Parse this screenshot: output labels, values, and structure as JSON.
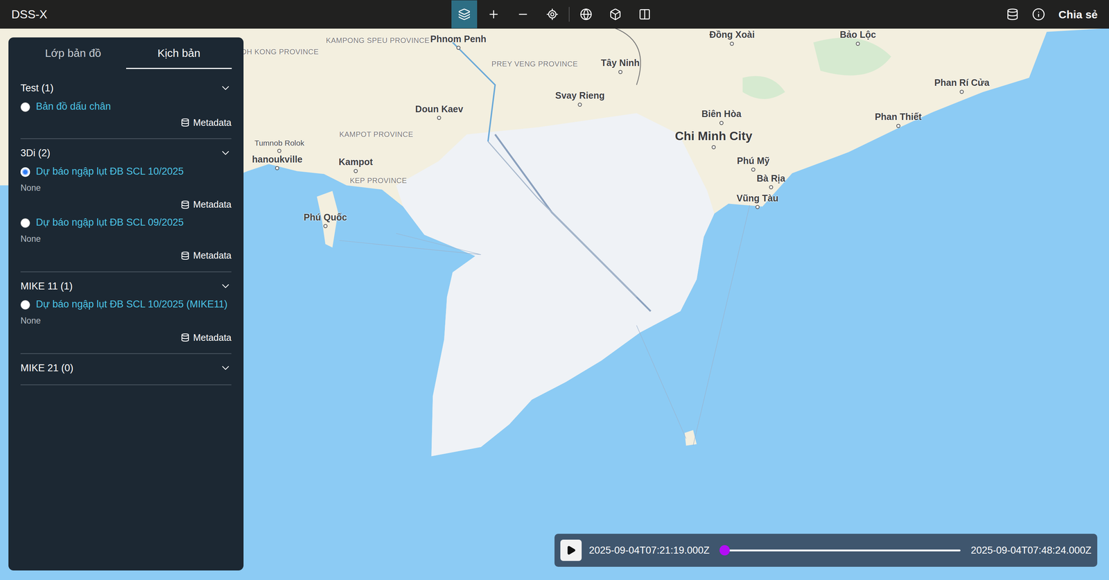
{
  "app": {
    "title": "DSS-X",
    "share": "Chia sẻ"
  },
  "toolbar": [
    {
      "selected": true
    },
    {
      "selected": false
    },
    {
      "selected": false
    },
    {
      "selected": false
    },
    {
      "selected": false
    },
    {
      "selected": false
    },
    {
      "selected": false
    }
  ],
  "panel": {
    "tabs": [
      {
        "label": "Lớp bản đồ",
        "selected": false
      },
      {
        "label": "Kịch bản",
        "selected": true
      }
    ],
    "groups": [
      {
        "title": "Test (1)",
        "expanded": true,
        "items": [
          {
            "label": "Bản đồ dấu chân",
            "selected": false,
            "note": "",
            "metadata": "Metadata"
          }
        ]
      },
      {
        "title": "3Di (2)",
        "expanded": true,
        "items": [
          {
            "label": "Dự báo ngập lụt ĐB SCL 10/2025",
            "selected": true,
            "note": "None",
            "metadata": "Metadata"
          },
          {
            "label": "Dự báo ngập lụt ĐB SCL 09/2025",
            "selected": false,
            "note": "None",
            "metadata": "Metadata"
          }
        ]
      },
      {
        "title": "MIKE 11 (1)",
        "expanded": true,
        "items": [
          {
            "label": "Dự báo ngập lụt ĐB SCL 10/2025 (MIKE11)",
            "selected": false,
            "note": "None",
            "metadata": "Metadata"
          }
        ]
      },
      {
        "title": "MIKE 21 (0)",
        "expanded": true,
        "items": []
      }
    ]
  },
  "map": {
    "labels": [
      {
        "text": "KOH KONG PROVINCE",
        "kind": "province"
      },
      {
        "text": "KAMPONG SPEU PROVINCE",
        "kind": "province"
      },
      {
        "text": "Phnom Penh",
        "kind": "city"
      },
      {
        "text": "PREY VENG PROVINCE",
        "kind": "province"
      },
      {
        "text": "Tây Ninh",
        "kind": "city"
      },
      {
        "text": "Đồng Xoài",
        "kind": "city"
      },
      {
        "text": "Bảo Lộc",
        "kind": "city"
      },
      {
        "text": "Svay Rieng",
        "kind": "city"
      },
      {
        "text": "Doun Kaev",
        "kind": "city"
      },
      {
        "text": "Biên Hòa",
        "kind": "city"
      },
      {
        "text": "Chi Minh City",
        "kind": "major"
      },
      {
        "text": "Phan Rí Cửa",
        "kind": "city"
      },
      {
        "text": "Phan Thiết",
        "kind": "city"
      },
      {
        "text": "KAMPOT PROVINCE",
        "kind": "province"
      },
      {
        "text": "Tumnob Rolok",
        "kind": "small"
      },
      {
        "text": "hanoukville",
        "kind": "city"
      },
      {
        "text": "Kampot",
        "kind": "city"
      },
      {
        "text": "KEP PROVINCE",
        "kind": "province"
      },
      {
        "text": "Phú Mỹ",
        "kind": "city"
      },
      {
        "text": "Bà Rịa",
        "kind": "city"
      },
      {
        "text": "Vũng Tàu",
        "kind": "city"
      },
      {
        "text": "Phú Quốc",
        "kind": "city"
      }
    ]
  },
  "timeline": {
    "start": "2025-09-04T07:21:19.000Z",
    "end": "2025-09-04T07:48:24.000Z",
    "level": 0.02,
    "playing": false
  }
}
